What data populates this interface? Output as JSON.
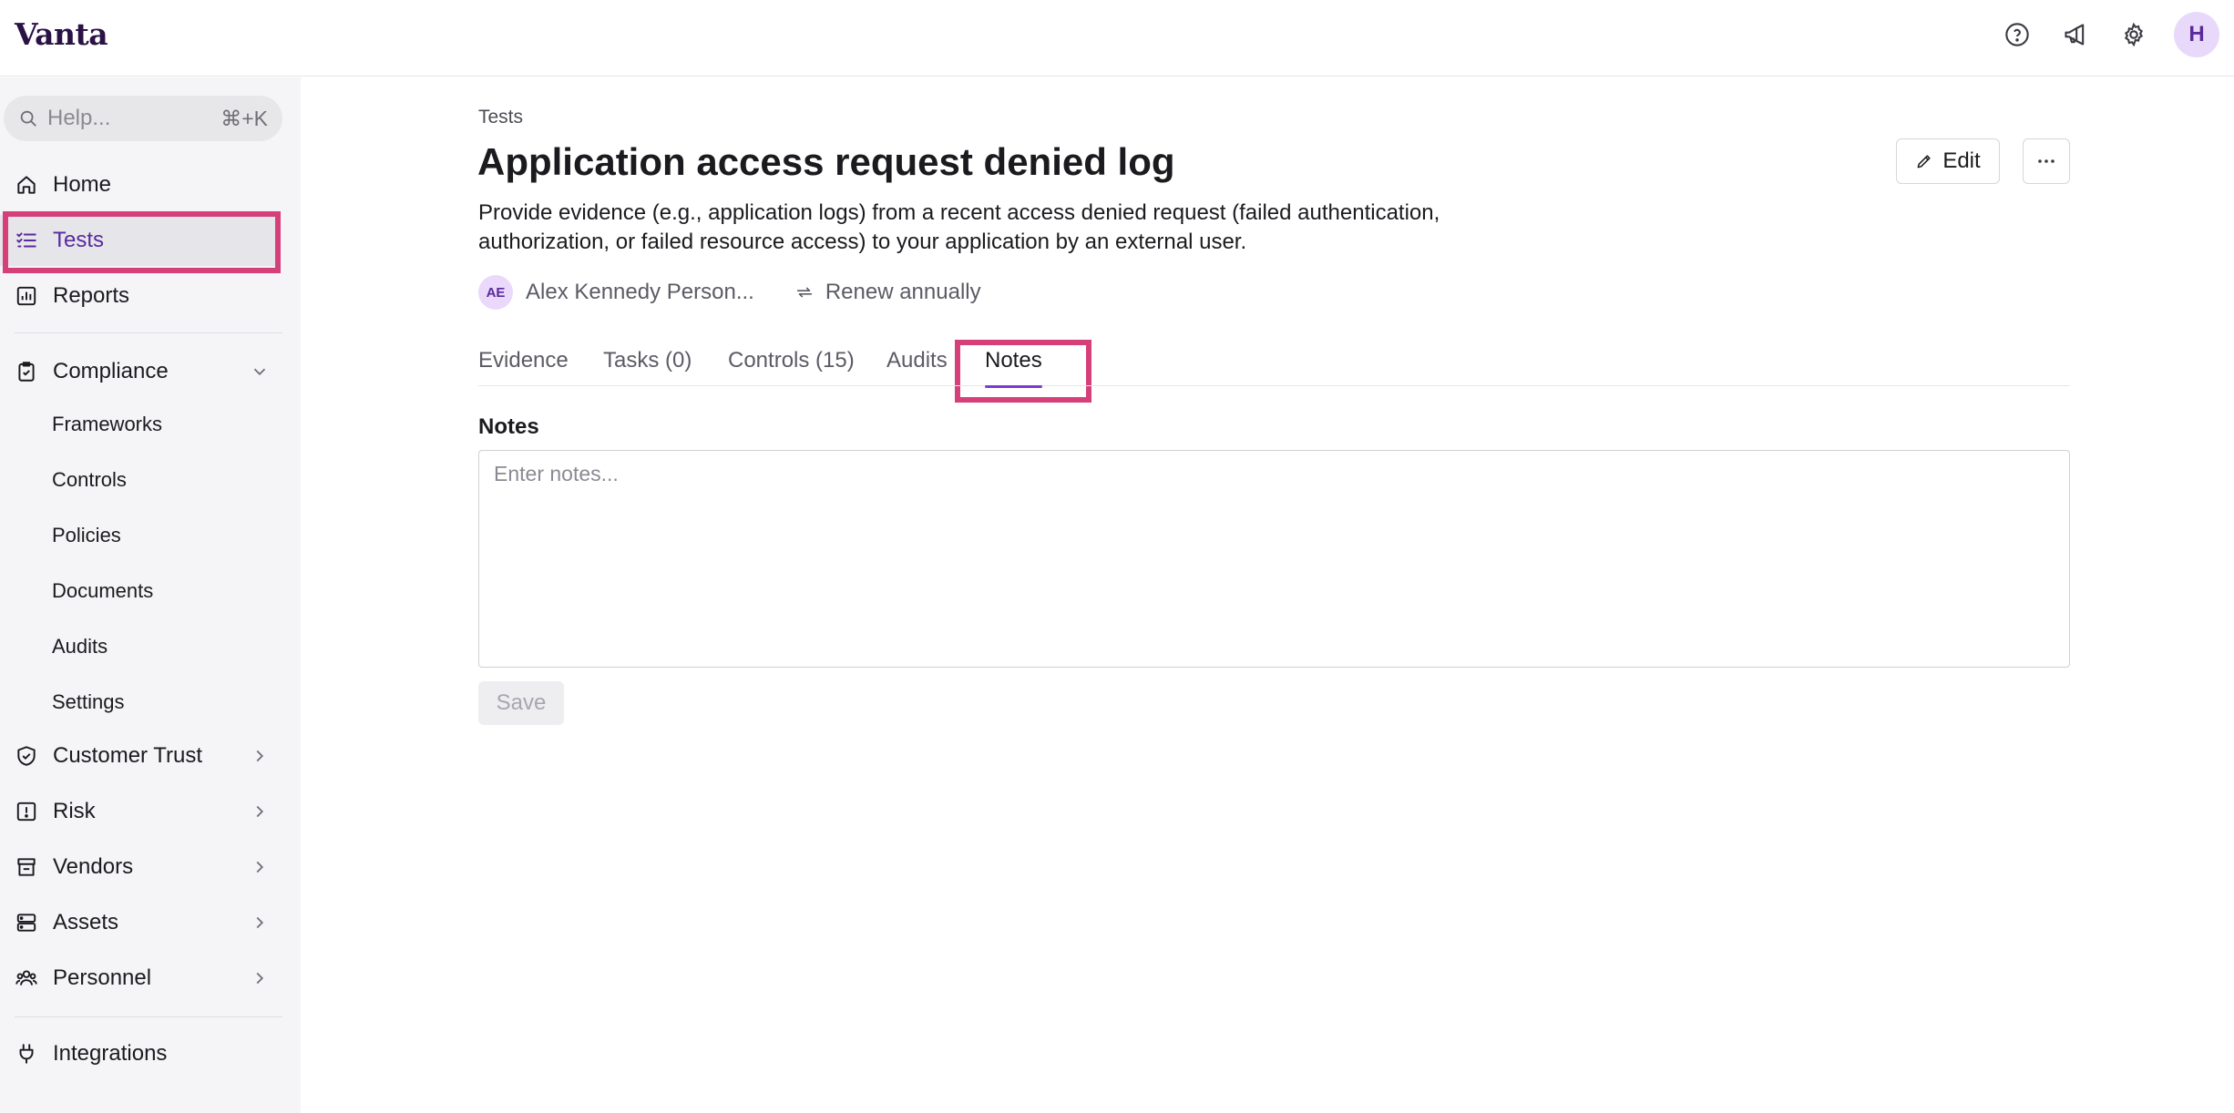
{
  "app": {
    "logo": "Vanta"
  },
  "topbar": {
    "icons": [
      "help-icon",
      "announcement-icon",
      "settings-icon"
    ],
    "user_initial": "H"
  },
  "sidebar": {
    "search": {
      "placeholder": "Help...",
      "shortcut": "⌘+K"
    },
    "items": [
      {
        "label": "Home",
        "icon": "home-icon"
      },
      {
        "label": "Tests",
        "icon": "checklist-icon",
        "active": true
      },
      {
        "label": "Reports",
        "icon": "report-icon"
      },
      {
        "label": "Compliance",
        "icon": "clipboard-icon",
        "expanded": true
      },
      {
        "label": "Customer Trust",
        "icon": "shield-icon"
      },
      {
        "label": "Risk",
        "icon": "alert-icon"
      },
      {
        "label": "Vendors",
        "icon": "vendor-icon"
      },
      {
        "label": "Assets",
        "icon": "server-icon"
      },
      {
        "label": "Personnel",
        "icon": "people-icon"
      },
      {
        "label": "Integrations",
        "icon": "plug-icon"
      }
    ],
    "compliance_sub": [
      "Frameworks",
      "Controls",
      "Policies",
      "Documents",
      "Audits",
      "Settings"
    ]
  },
  "main": {
    "breadcrumb": "Tests",
    "title": "Application access request denied log",
    "description": "Provide evidence (e.g., application logs) from a recent access denied request (failed authentication, authorization, or failed resource access) to your application by an external user.",
    "owner": {
      "initials": "AE",
      "name": "Alex Kennedy Person..."
    },
    "renewal": "Renew annually",
    "edit_label": "Edit",
    "tabs": [
      "Evidence",
      "Tasks (0)",
      "Controls (15)",
      "Audits",
      "Notes"
    ],
    "active_tab": "Notes",
    "notes": {
      "label": "Notes",
      "placeholder": "Enter notes...",
      "value": "",
      "save_label": "Save"
    }
  },
  "colors": {
    "accent": "#7a3cd0",
    "highlight": "#d6407a",
    "brand": "#2a1245"
  }
}
